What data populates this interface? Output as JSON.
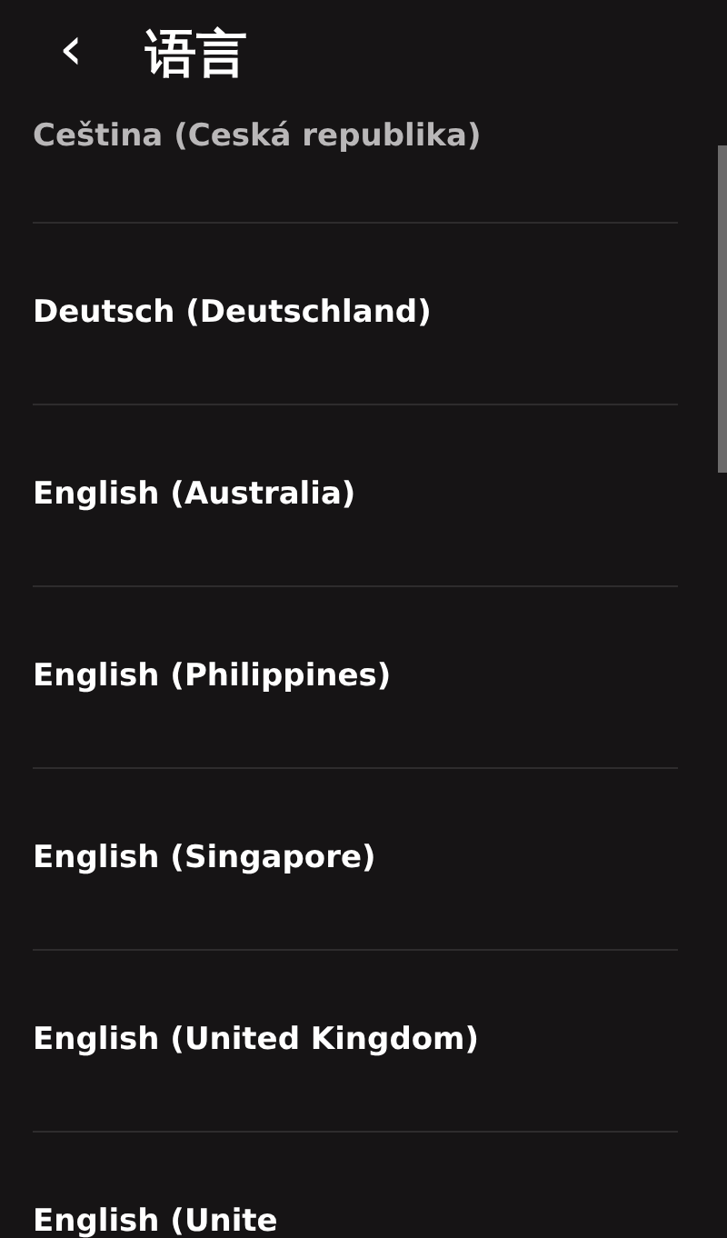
{
  "header": {
    "back": "‹",
    "title": "语言"
  },
  "languages": [
    {
      "label": "Ceština (Ceská republika)",
      "dimmed": true
    },
    {
      "label": "Deutsch (Deutschland)",
      "dimmed": false
    },
    {
      "label": "English (Australia)",
      "dimmed": false
    },
    {
      "label": "English (Philippines)",
      "dimmed": false
    },
    {
      "label": "English (Singapore)",
      "dimmed": false
    },
    {
      "label": "English (United Kingdom)",
      "dimmed": false
    },
    {
      "label": "English (Unite",
      "dimmed": false
    }
  ]
}
